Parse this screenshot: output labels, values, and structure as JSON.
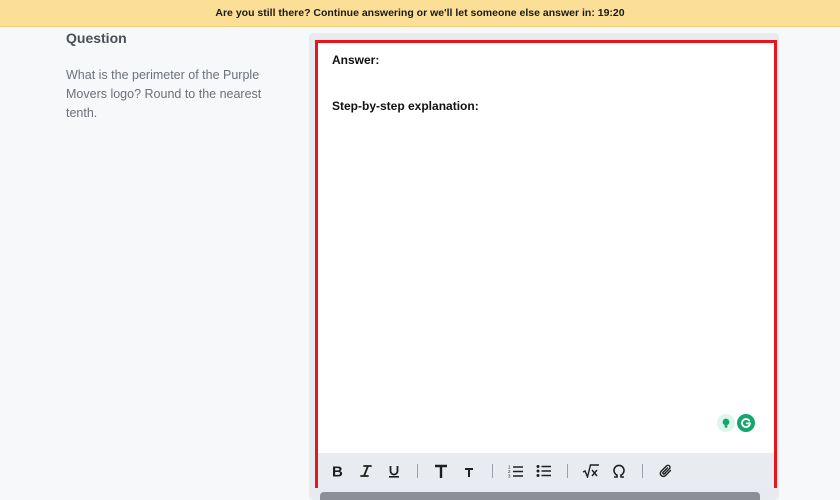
{
  "banner": {
    "text": "Are you still there? Continue answering or we'll let someone else answer in: 19:20"
  },
  "question": {
    "heading": "Question",
    "text": "What is the perimeter of the Purple Movers logo? Round to the nearest tenth."
  },
  "editor": {
    "answer_label": "Answer:",
    "explanation_label": "Step-by-step explanation:"
  },
  "toolbar": {
    "icons": [
      "bold-icon",
      "italic-icon",
      "underline-icon",
      "large-text-icon",
      "small-text-icon",
      "numbered-list-icon",
      "bulleted-list-icon",
      "square-root-icon",
      "omega-icon",
      "paperclip-icon"
    ]
  },
  "colors": {
    "banner_bg": "#fbdf96",
    "highlight_border": "#e3171c",
    "toolbar_bg": "#e8ecf0",
    "grammarly_green": "#15a66e"
  }
}
